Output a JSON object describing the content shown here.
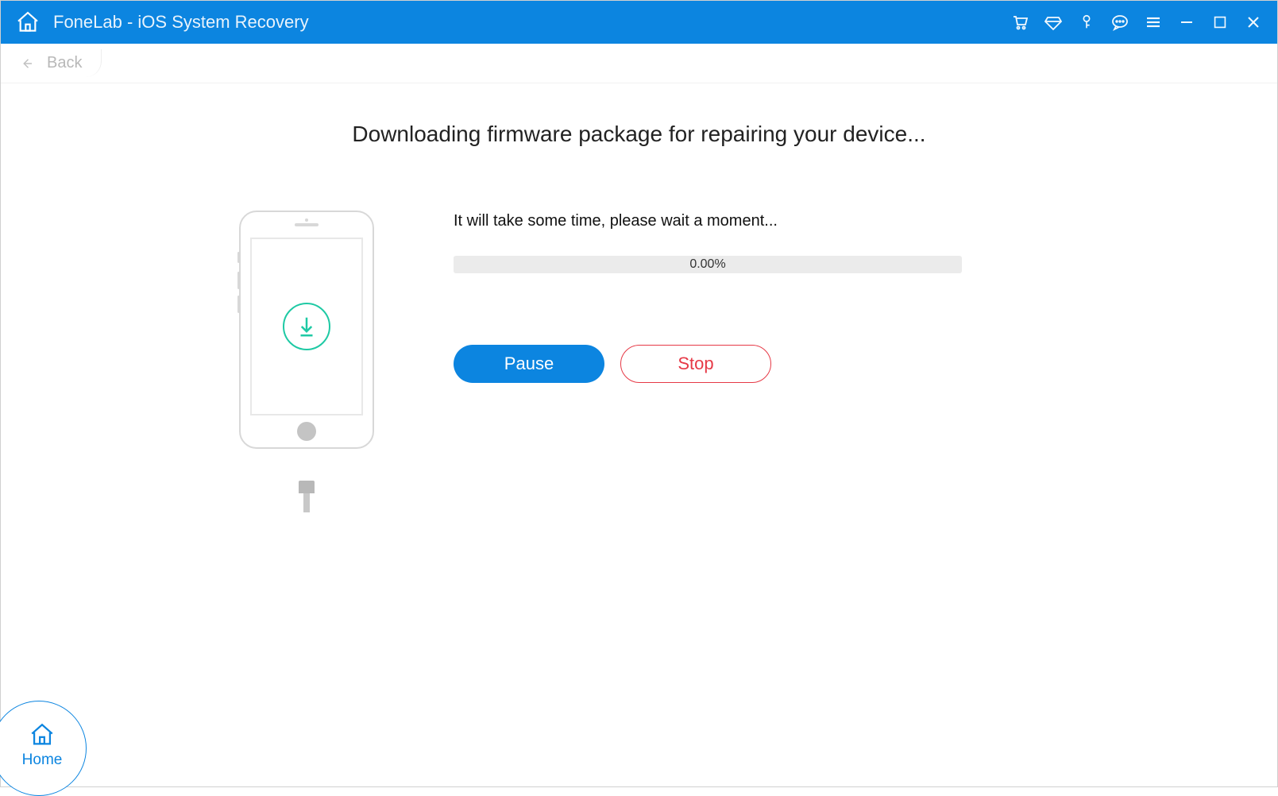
{
  "titlebar": {
    "app_title": "FoneLab - iOS System Recovery"
  },
  "nav": {
    "back_label": "Back"
  },
  "main": {
    "heading": "Downloading firmware package for repairing your device...",
    "wait_text": "It will take some time, please wait a moment...",
    "progress_percent": "0.00%",
    "pause_label": "Pause",
    "stop_label": "Stop"
  },
  "home": {
    "label": "Home"
  },
  "colors": {
    "primary": "#0c85e0",
    "accent_green": "#1ec9a4",
    "danger": "#e63946"
  }
}
